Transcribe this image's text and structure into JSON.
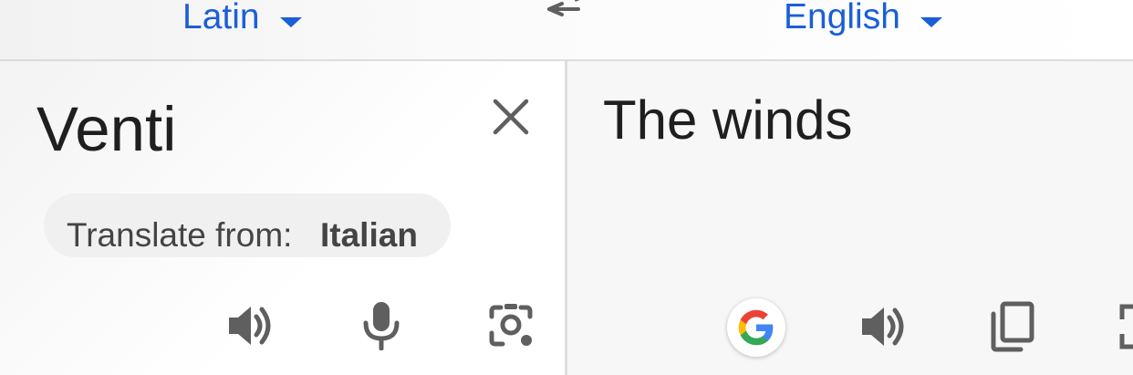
{
  "header": {
    "source_language": "Latin",
    "target_language": "English"
  },
  "source": {
    "text": "Venti",
    "suggestion_label": "Translate from:",
    "suggestion_value": "Italian"
  },
  "target": {
    "text": "The winds"
  },
  "colors": {
    "accent": "#1a5fd6",
    "text": "#1f1f1f",
    "icon": "#5f5f5f"
  },
  "icons": [
    "swap-icon",
    "close-icon",
    "speaker-icon",
    "microphone-icon",
    "camera-icon",
    "google-icon",
    "copy-icon",
    "expand-icon"
  ]
}
